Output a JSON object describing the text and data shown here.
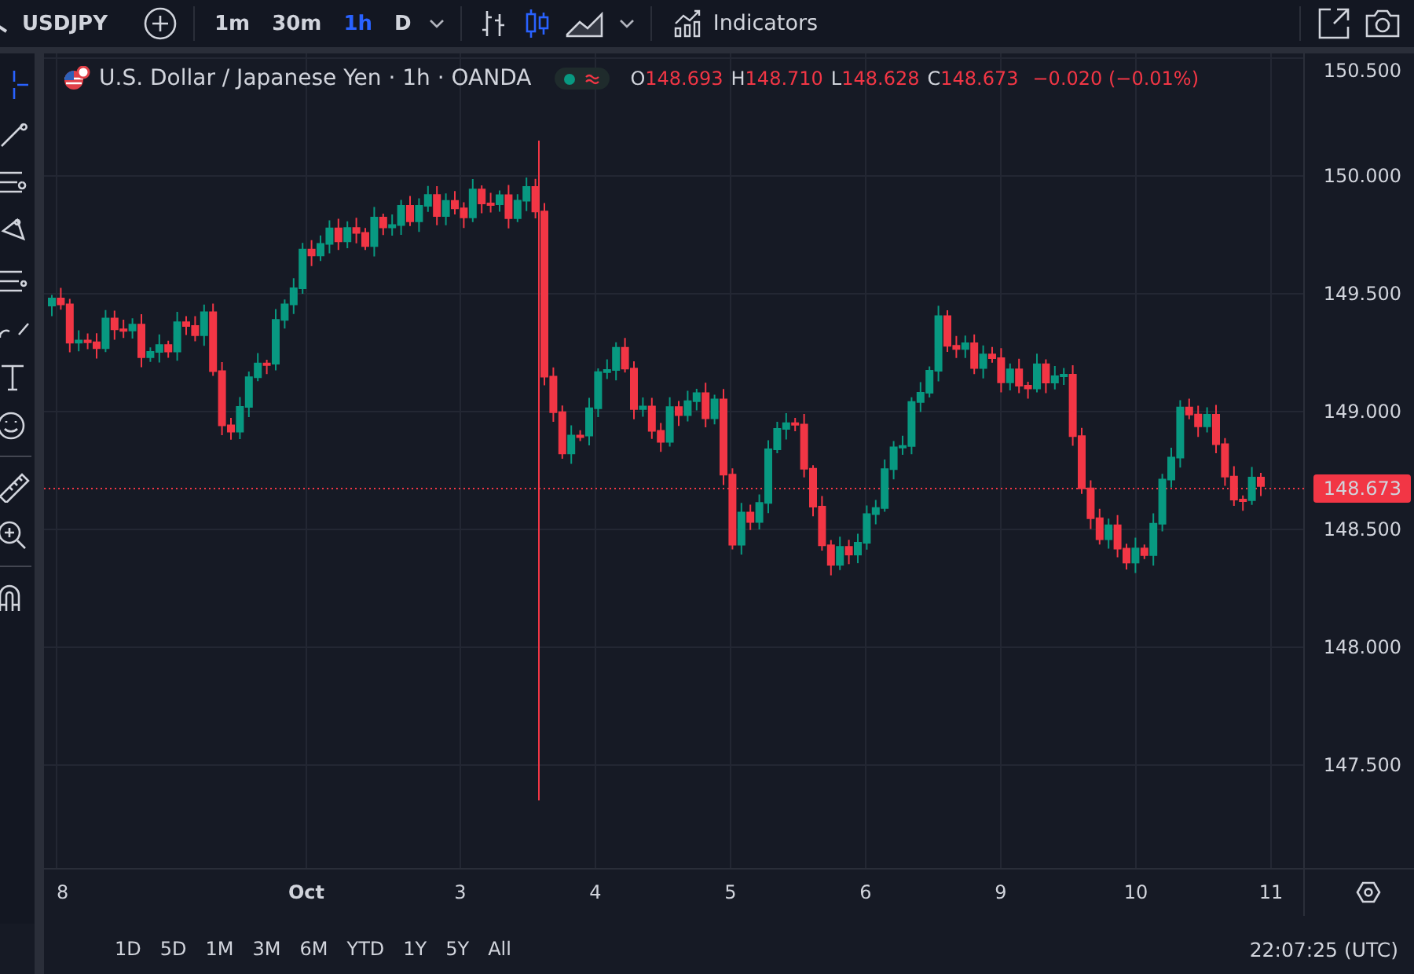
{
  "toolbar": {
    "symbol": "USDJPY",
    "intervals": [
      {
        "label": "1m",
        "selected": false
      },
      {
        "label": "30m",
        "selected": false
      },
      {
        "label": "1h",
        "selected": true
      },
      {
        "label": "D",
        "selected": false
      }
    ],
    "chart_styles": [
      {
        "kind": "bars",
        "selected": false
      },
      {
        "kind": "candles",
        "selected": true
      },
      {
        "kind": "area",
        "selected": false
      }
    ],
    "indicators": "Indicators"
  },
  "left_tools": [
    {
      "kind": "crosshair",
      "selected": true
    },
    {
      "kind": "trend",
      "selected": false
    },
    {
      "kind": "fib",
      "selected": false
    },
    {
      "kind": "pattern",
      "selected": false
    },
    {
      "kind": "channel",
      "selected": false
    },
    {
      "kind": "brush",
      "selected": false
    },
    {
      "kind": "text",
      "selected": false
    },
    {
      "kind": "emoji",
      "selected": false
    },
    {
      "kind": "ruler",
      "selected": false
    },
    {
      "kind": "zoom",
      "selected": false
    },
    {
      "kind": "magnet",
      "selected": false
    }
  ],
  "legend": {
    "title": "U.S. Dollar / Japanese Yen · 1h · OANDA",
    "market_open": true,
    "ohlc": [
      {
        "key": "O",
        "value": "148.693"
      },
      {
        "key": "H",
        "value": "148.710"
      },
      {
        "key": "L",
        "value": "148.628"
      },
      {
        "key": "C",
        "value": "148.673"
      }
    ],
    "change": "−0.020 (−0.01%)"
  },
  "price_axis": {
    "labels": [
      "150.500",
      "150.000",
      "149.500",
      "149.000",
      "148.500",
      "148.000",
      "147.500"
    ],
    "last_price": "148.673"
  },
  "time_axis": {
    "labels": [
      "8",
      "Oct",
      "3",
      "4",
      "5",
      "6",
      "9",
      "10",
      "11"
    ]
  },
  "ranges": [
    "1D",
    "5D",
    "1M",
    "3M",
    "6M",
    "YTD",
    "1Y",
    "5Y",
    "All"
  ],
  "clock": "22:07:25 (UTC)"
}
